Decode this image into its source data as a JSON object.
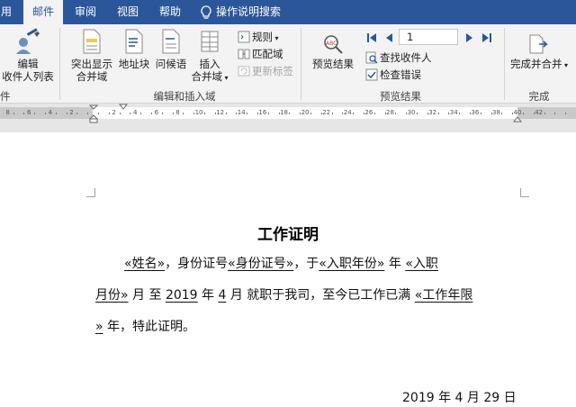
{
  "tabs": [
    {
      "label": "用",
      "active": false
    },
    {
      "label": "邮件",
      "active": true
    },
    {
      "label": "审阅",
      "active": false
    },
    {
      "label": "视图",
      "active": false
    },
    {
      "label": "帮助",
      "active": false
    },
    {
      "label": "操作说明搜索",
      "active": false
    }
  ],
  "ribbon": {
    "edit_recipients": {
      "line1": "编辑",
      "line2": "收件人列表"
    },
    "left_group_label": "件",
    "highlight_merge_fields": {
      "line1": "突出显示",
      "line2": "合并域"
    },
    "address_block": "地址块",
    "greeting_line": "问候语",
    "insert_merge_field": {
      "line1": "插入",
      "line2": "合并域"
    },
    "rules": "规则",
    "match_fields": "匹配域",
    "update_labels": "更新标签",
    "group_write_insert": "编辑和插入域",
    "preview_results": "预览结果",
    "record_number": "1",
    "find_recipient": "查找收件人",
    "check_errors": "检查错误",
    "group_preview": "预览结果",
    "finish_merge": "完成并合并",
    "group_finish": "完成"
  },
  "ruler_labels": [
    "8",
    "6",
    "4",
    "2",
    "2",
    "4",
    "6",
    "8",
    "10",
    "12",
    "14",
    "16",
    "18",
    "20",
    "22",
    "24",
    "26",
    "28",
    "30",
    "32",
    "34",
    "36",
    "38",
    "40",
    "42"
  ],
  "document": {
    "title": "工作证明",
    "l1": {
      "f_name": "«姓名»",
      "t1": "，身份证号",
      "f_id": "«身份证号»",
      "t2": "，于",
      "f_year": "«入职年份»",
      "t3": "年",
      "f_month_a": "«入职"
    },
    "l2": {
      "f_month_b": "月份»",
      "t1": "月 至",
      "year": "2019",
      "t2": "年",
      "month": "4",
      "t3": "月 就职于我司，至今已工作已满",
      "f_years_a": "«工作年限"
    },
    "l3": {
      "f_years_b": "»",
      "t1": "年，特此证明。"
    },
    "date": "2019 年 4 月 29 日"
  },
  "colors": {
    "accent": "#2b579a",
    "ribbon_bg": "#f3f3f3",
    "page_bg": "#ffffff"
  }
}
